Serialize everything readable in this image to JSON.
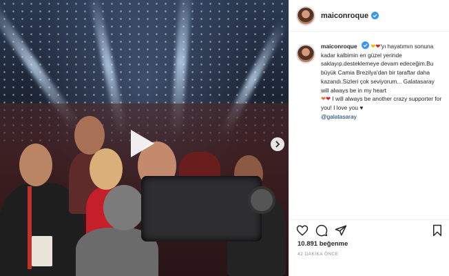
{
  "post": {
    "username": "maiconroque",
    "caption": {
      "user": "maiconroque",
      "hearts_intro": [
        "yellow-heart",
        "red-heart"
      ],
      "text_1": "'yı hayatımın sonuna kadar kalbimin en güzel yerinde saklayıp,desteklemeye devam edeceğim.Bu büyük Camia Brezilya'dan bir taraftar daha kazandı.Sizleri çok seviyorum... Galatasaray will always be in my heart",
      "hearts_mid": [
        "orange-heart",
        "red-heart"
      ],
      "text_2": " I will always be another crazy supporter for you! I love you",
      "hearts_end": [
        "black-heart"
      ],
      "mention": "@galatasaray"
    },
    "likes": "10.891 beğenme",
    "time_ago": "42 DAKİKA ÖNCE"
  },
  "icons": {
    "verified": "verified-badge-icon",
    "play": "play-icon",
    "next": "chevron-right-icon",
    "like": "heart-outline-icon",
    "comment": "comment-icon",
    "share": "paper-plane-icon",
    "save": "bookmark-icon"
  },
  "colors": {
    "verified_blue": "#3897f0",
    "text": "#262626",
    "muted": "#8e8e8e",
    "link": "#00376b"
  }
}
